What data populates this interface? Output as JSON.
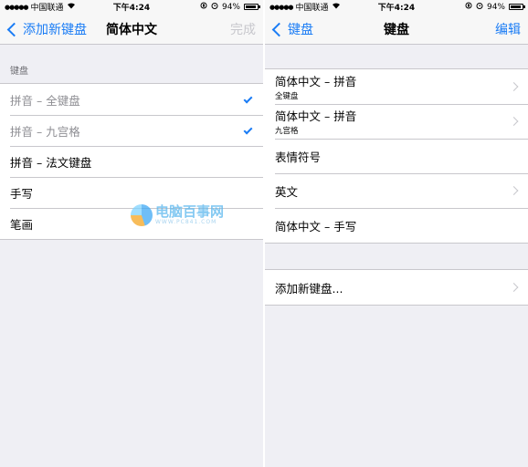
{
  "status_bar": {
    "carrier": "中国联通",
    "time": "下午4:24",
    "battery_text": "94%",
    "battery_level": 0.94
  },
  "left": {
    "nav": {
      "back_label": "添加新键盘",
      "title": "简体中文",
      "done_label": "完成"
    },
    "section_header": "键盘",
    "items": [
      {
        "label": "拼音 – 全键盘",
        "checked": true
      },
      {
        "label": "拼音 – 九宫格",
        "checked": true
      },
      {
        "label": "拼音 – 法文键盘",
        "checked": false
      },
      {
        "label": "手写",
        "checked": false
      },
      {
        "label": "笔画",
        "checked": false
      }
    ]
  },
  "right": {
    "nav": {
      "back_label": "键盘",
      "title": "键盘",
      "edit_label": "编辑"
    },
    "keyboards": [
      {
        "label": "简体中文 – 拼音",
        "subtitle": "全键盘"
      },
      {
        "label": "简体中文 – 拼音",
        "subtitle": "九宫格"
      },
      {
        "label": "表情符号",
        "subtitle": ""
      },
      {
        "label": "英文",
        "subtitle": ""
      },
      {
        "label": "简体中文 – 手写",
        "subtitle": ""
      }
    ],
    "add_label": "添加新键盘..."
  },
  "watermark": {
    "main": "电脑百事网",
    "sub": "WWW.PC841.COM"
  },
  "colors": {
    "accent": "#1a7cf5",
    "background": "#efeff4",
    "separator": "#c8c7cc"
  }
}
